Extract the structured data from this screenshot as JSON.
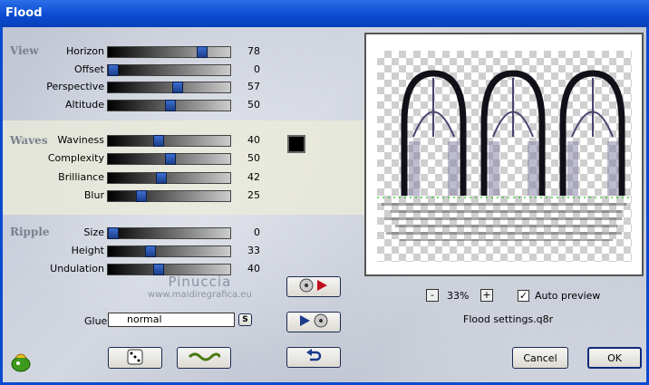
{
  "window": {
    "title": "Flood"
  },
  "sections": {
    "view": {
      "title": "View"
    },
    "waves": {
      "title": "Waves"
    },
    "ripple": {
      "title": "Ripple"
    }
  },
  "sliders": [
    {
      "label": "Horizon",
      "value": 78
    },
    {
      "label": "Offset",
      "value": 0
    },
    {
      "label": "Perspective",
      "value": 57
    },
    {
      "label": "Altitude",
      "value": 50
    },
    {
      "label": "Waviness",
      "value": 40
    },
    {
      "label": "Complexity",
      "value": 50
    },
    {
      "label": "Brilliance",
      "value": 42
    },
    {
      "label": "Blur",
      "value": 25
    },
    {
      "label": "Size",
      "value": 0
    },
    {
      "label": "Height",
      "value": 33
    },
    {
      "label": "Undulation",
      "value": 40
    }
  ],
  "waves_color": "#000000",
  "watermark": {
    "line1": "Pinuccia",
    "line2": "www.maidiregrafica.eu"
  },
  "glue": {
    "label": "Glue",
    "value": "normal",
    "button": "S"
  },
  "preview": {
    "zoom": "33%",
    "zoom_out": "-",
    "zoom_in": "+",
    "auto_preview_label": "Auto preview",
    "auto_preview_checked": true,
    "settings_file": "Flood settings.q8r"
  },
  "buttons": {
    "cancel": "Cancel",
    "ok": "OK"
  },
  "icons": {
    "app": "flood-plugin-icon",
    "dice": "dice-icon",
    "wave": "wave-icon",
    "load": "load-settings-icon",
    "save": "save-settings-icon",
    "reset": "reset-icon"
  }
}
